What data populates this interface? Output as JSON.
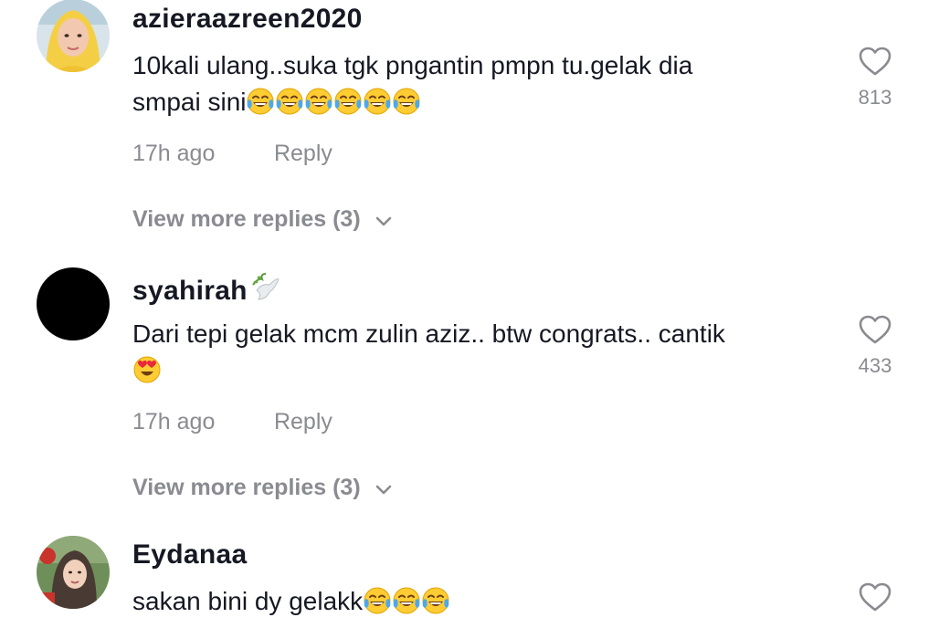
{
  "comments": [
    {
      "username": "azieraazreen2020",
      "text_line1": "10kali ulang..suka tgk pngantin pmpn tu.gelak dia",
      "text_line2": "smpai sini",
      "emojis": [
        "tears-of-joy-emoji",
        "tears-of-joy-emoji",
        "tears-of-joy-emoji",
        "tears-of-joy-emoji",
        "tears-of-joy-emoji",
        "tears-of-joy-emoji"
      ],
      "time": "17h ago",
      "reply_label": "Reply",
      "likes": "813",
      "view_more": "View more replies (3)"
    },
    {
      "username": "syahirah",
      "username_emoji": "dove-emoji",
      "text_line1": "Dari tepi gelak mcm zulin aziz.. btw congrats.. cantik",
      "emojis": [
        "heart-eyes-emoji"
      ],
      "time": "17h ago",
      "reply_label": "Reply",
      "likes": "433",
      "view_more": "View more replies (3)"
    },
    {
      "username": "Eydanaa",
      "text_line1": "sakan bini dy gelakk",
      "emojis": [
        "tears-of-joy-emoji",
        "tears-of-joy-emoji",
        "tears-of-joy-emoji"
      ]
    }
  ],
  "icons": {
    "like": "heart-outline-icon",
    "expand": "chevron-down-icon"
  },
  "colors": {
    "primary_text": "#161823",
    "secondary_text": "#8a8b91"
  }
}
